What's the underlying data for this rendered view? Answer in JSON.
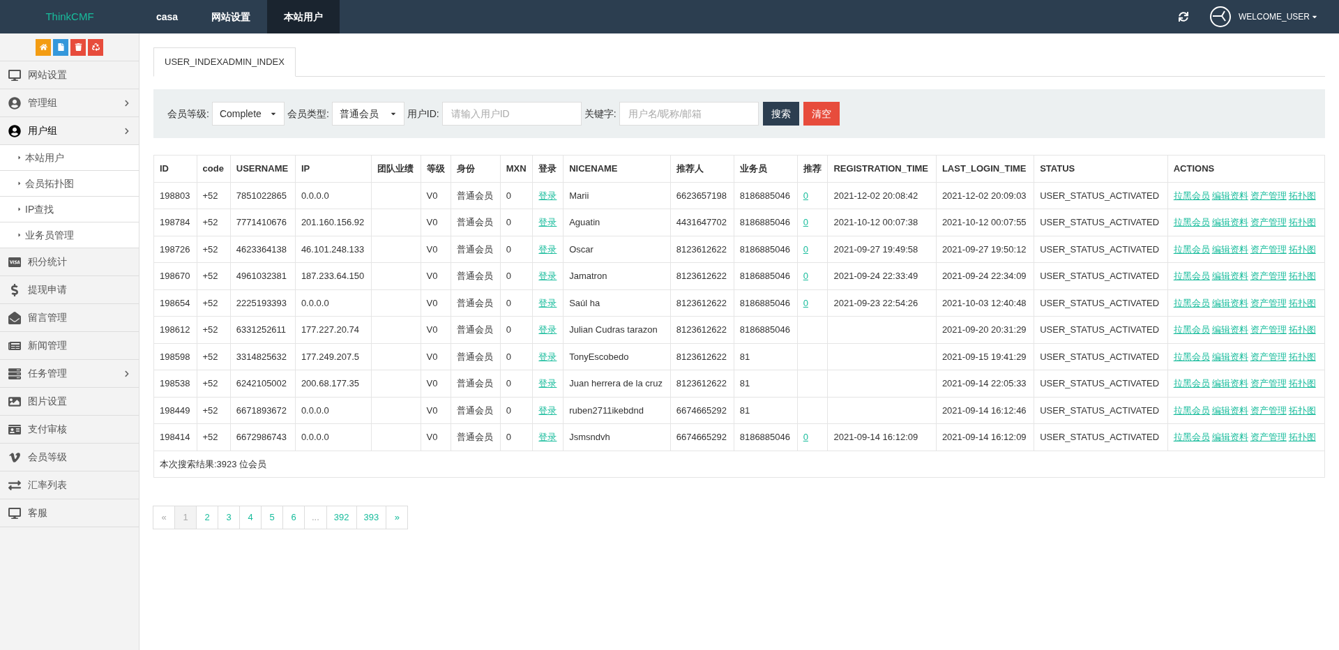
{
  "topbar": {
    "brand": "ThinkCMF",
    "nav": [
      {
        "label": "casa",
        "selected": false
      },
      {
        "label": "网站设置",
        "selected": false
      },
      {
        "label": "本站用户",
        "selected": true
      }
    ],
    "user": "WELCOME_USER"
  },
  "sidebar": {
    "quick_buttons": [
      {
        "color": "#f39c12"
      },
      {
        "color": "#3498db"
      },
      {
        "color": "#e74c3c"
      },
      {
        "color": "#e74c3c"
      }
    ],
    "items": [
      {
        "label": "网站设置",
        "has_submenu": false,
        "expanded": false
      },
      {
        "label": "管理组",
        "has_submenu": true,
        "expanded": false
      },
      {
        "label": "用户组",
        "has_submenu": true,
        "expanded": true,
        "children": [
          {
            "label": "本站用户"
          },
          {
            "label": "会员拓扑图"
          },
          {
            "label": "IP查找"
          },
          {
            "label": "业务员管理"
          }
        ]
      },
      {
        "label": "积分统计",
        "has_submenu": false,
        "expanded": false
      },
      {
        "label": "提现申请",
        "has_submenu": false,
        "expanded": false
      },
      {
        "label": "留言管理",
        "has_submenu": false,
        "expanded": false
      },
      {
        "label": "新闻管理",
        "has_submenu": false,
        "expanded": false
      },
      {
        "label": "任务管理",
        "has_submenu": true,
        "expanded": false
      },
      {
        "label": "图片设置",
        "has_submenu": false,
        "expanded": false
      },
      {
        "label": "支付审核",
        "has_submenu": false,
        "expanded": false
      },
      {
        "label": "会员等级",
        "has_submenu": false,
        "expanded": false
      },
      {
        "label": "汇率列表",
        "has_submenu": false,
        "expanded": false
      },
      {
        "label": "客服",
        "has_submenu": false,
        "expanded": false
      }
    ]
  },
  "page_tab": "USER_INDEXADMIN_INDEX",
  "filter": {
    "fields": [
      {
        "kind": "select",
        "label": "会员等级:",
        "value": "Complete"
      },
      {
        "kind": "select",
        "label": "会员类型:",
        "value": "普通会员"
      },
      {
        "kind": "input",
        "label": "用户ID:",
        "placeholder": "请输入用户ID"
      },
      {
        "kind": "input",
        "label": "关键字:",
        "placeholder": "用户名/昵称/邮箱"
      }
    ],
    "buttons": [
      {
        "kind": "primary",
        "label": "搜索"
      },
      {
        "kind": "danger",
        "label": "清空"
      }
    ]
  },
  "table": {
    "columns": [
      "ID",
      "code",
      "USERNAME",
      "IP",
      "团队业绩",
      "等级",
      "身份",
      "MXN",
      "登录",
      "NICENAME",
      "推荐人",
      "业务员",
      "推荐",
      "REGISTRATION_TIME",
      "LAST_LOGIN_TIME",
      "STATUS",
      "ACTIONS"
    ],
    "rows": [
      {
        "id": "198803",
        "code": "+52",
        "username": "7851022865",
        "ip": "0.0.0.0",
        "level": "V0",
        "identity": "普通会员",
        "mxn": "0",
        "login": "登录",
        "nicename": "Marii",
        "referrer": "6623657198",
        "salesman": "8186885046",
        "recommend": "0",
        "registration_time": "2021-12-02 20:08:42",
        "last_login_time": "2021-12-02 20:09:03",
        "status": "USER_STATUS_ACTIVATED",
        "actions": [
          "拉黑会员",
          "编辑资料",
          "资产管理",
          "拓扑图"
        ]
      },
      {
        "id": "198784",
        "code": "+52",
        "username": "7771410676",
        "ip": "201.160.156.92",
        "level": "V0",
        "identity": "普通会员",
        "mxn": "0",
        "login": "登录",
        "nicename": "Aguatin",
        "referrer": "4431647702",
        "salesman": "8186885046",
        "recommend": "0",
        "registration_time": "2021-10-12 00:07:38",
        "last_login_time": "2021-10-12 00:07:55",
        "status": "USER_STATUS_ACTIVATED",
        "actions": [
          "拉黑会员",
          "编辑资料",
          "资产管理",
          "拓扑图"
        ]
      },
      {
        "id": "198726",
        "code": "+52",
        "username": "4623364138",
        "ip": "46.101.248.133",
        "level": "V0",
        "identity": "普通会员",
        "mxn": "0",
        "login": "登录",
        "nicename": "Oscar",
        "referrer": "8123612622",
        "salesman": "8186885046",
        "recommend": "0",
        "registration_time": "2021-09-27 19:49:58",
        "last_login_time": "2021-09-27 19:50:12",
        "status": "USER_STATUS_ACTIVATED",
        "actions": [
          "拉黑会员",
          "编辑资料",
          "资产管理",
          "拓扑图"
        ]
      },
      {
        "id": "198670",
        "code": "+52",
        "username": "4961032381",
        "ip": "187.233.64.150",
        "level": "V0",
        "identity": "普通会员",
        "mxn": "0",
        "login": "登录",
        "nicename": "Jamatron",
        "referrer": "8123612622",
        "salesman": "8186885046",
        "recommend": "0",
        "registration_time": "2021-09-24 22:33:49",
        "last_login_time": "2021-09-24 22:34:09",
        "status": "USER_STATUS_ACTIVATED",
        "actions": [
          "拉黑会员",
          "编辑资料",
          "资产管理",
          "拓扑图"
        ]
      },
      {
        "id": "198654",
        "code": "+52",
        "username": "2225193393",
        "ip": "0.0.0.0",
        "level": "V0",
        "identity": "普通会员",
        "mxn": "0",
        "login": "登录",
        "nicename": "Saúl ha",
        "referrer": "8123612622",
        "salesman": "8186885046",
        "recommend": "0",
        "registration_time": "2021-09-23 22:54:26",
        "last_login_time": "2021-10-03 12:40:48",
        "status": "USER_STATUS_ACTIVATED",
        "actions": [
          "拉黑会员",
          "编辑资料",
          "资产管理",
          "拓扑图"
        ]
      },
      {
        "id": "198612",
        "code": "+52",
        "username": "6331252611",
        "ip": "177.227.20.74",
        "level": "V0",
        "identity": "普通会员",
        "mxn": "0",
        "login": "登录",
        "nicename": "Julian Cudras tarazon",
        "referrer": "8123612622",
        "salesman": "8186885046",
        "last_login_time": "2021-09-20 20:31:29",
        "status": "USER_STATUS_ACTIVATED",
        "actions": [
          "拉黑会员",
          "编辑资料",
          "资产管理",
          "拓扑图"
        ]
      },
      {
        "id": "198598",
        "code": "+52",
        "username": "3314825632",
        "ip": "177.249.207.5",
        "level": "V0",
        "identity": "普通会员",
        "mxn": "0",
        "login": "登录",
        "nicename": "TonyEscobedo",
        "referrer": "8123612622",
        "salesman": "81",
        "last_login_time": "2021-09-15 19:41:29",
        "status": "USER_STATUS_ACTIVATED",
        "actions": [
          "拉黑会员",
          "编辑资料",
          "资产管理",
          "拓扑图"
        ]
      },
      {
        "id": "198538",
        "code": "+52",
        "username": "6242105002",
        "ip": "200.68.177.35",
        "level": "V0",
        "identity": "普通会员",
        "mxn": "0",
        "login": "登录",
        "nicename": "Juan herrera de la cruz",
        "referrer": "8123612622",
        "salesman": "81",
        "last_login_time": "2021-09-14 22:05:33",
        "status": "USER_STATUS_ACTIVATED",
        "actions": [
          "拉黑会员",
          "编辑资料",
          "资产管理",
          "拓扑图"
        ]
      },
      {
        "id": "198449",
        "code": "+52",
        "username": "6671893672",
        "ip": "0.0.0.0",
        "level": "V0",
        "identity": "普通会员",
        "mxn": "0",
        "login": "登录",
        "nicename": "ruben2711ikebdnd",
        "referrer": "6674665292",
        "salesman": "81",
        "last_login_time": "2021-09-14 16:12:46",
        "status": "USER_STATUS_ACTIVATED",
        "actions": [
          "拉黑会员",
          "编辑资料",
          "资产管理",
          "拓扑图"
        ]
      },
      {
        "id": "198414",
        "code": "+52",
        "username": "6672986743",
        "ip": "0.0.0.0",
        "level": "V0",
        "identity": "普通会员",
        "mxn": "0",
        "login": "登录",
        "nicename": "Jsmsndvh",
        "referrer": "6674665292",
        "salesman": "8186885046",
        "recommend": "0",
        "registration_time": "2021-09-14 16:12:09",
        "last_login_time": "2021-09-14 16:12:09",
        "status": "USER_STATUS_ACTIVATED",
        "actions": [
          "拉黑会员",
          "编辑资料",
          "资产管理",
          "拓扑图"
        ]
      }
    ],
    "footer": "本次搜索结果:3923 位会员"
  },
  "pagination": [
    {
      "label": "«",
      "selected": false,
      "disabled": true
    },
    {
      "label": "1",
      "selected": true,
      "disabled": false
    },
    {
      "label": "2",
      "selected": false,
      "disabled": false
    },
    {
      "label": "3",
      "selected": false,
      "disabled": false
    },
    {
      "label": "4",
      "selected": false,
      "disabled": false
    },
    {
      "label": "5",
      "selected": false,
      "disabled": false
    },
    {
      "label": "6",
      "selected": false,
      "disabled": false
    },
    {
      "label": "...",
      "selected": false,
      "disabled": true
    },
    {
      "label": "392",
      "selected": false,
      "disabled": false
    },
    {
      "label": "393",
      "selected": false,
      "disabled": false
    },
    {
      "label": "»",
      "selected": false,
      "disabled": false
    }
  ]
}
